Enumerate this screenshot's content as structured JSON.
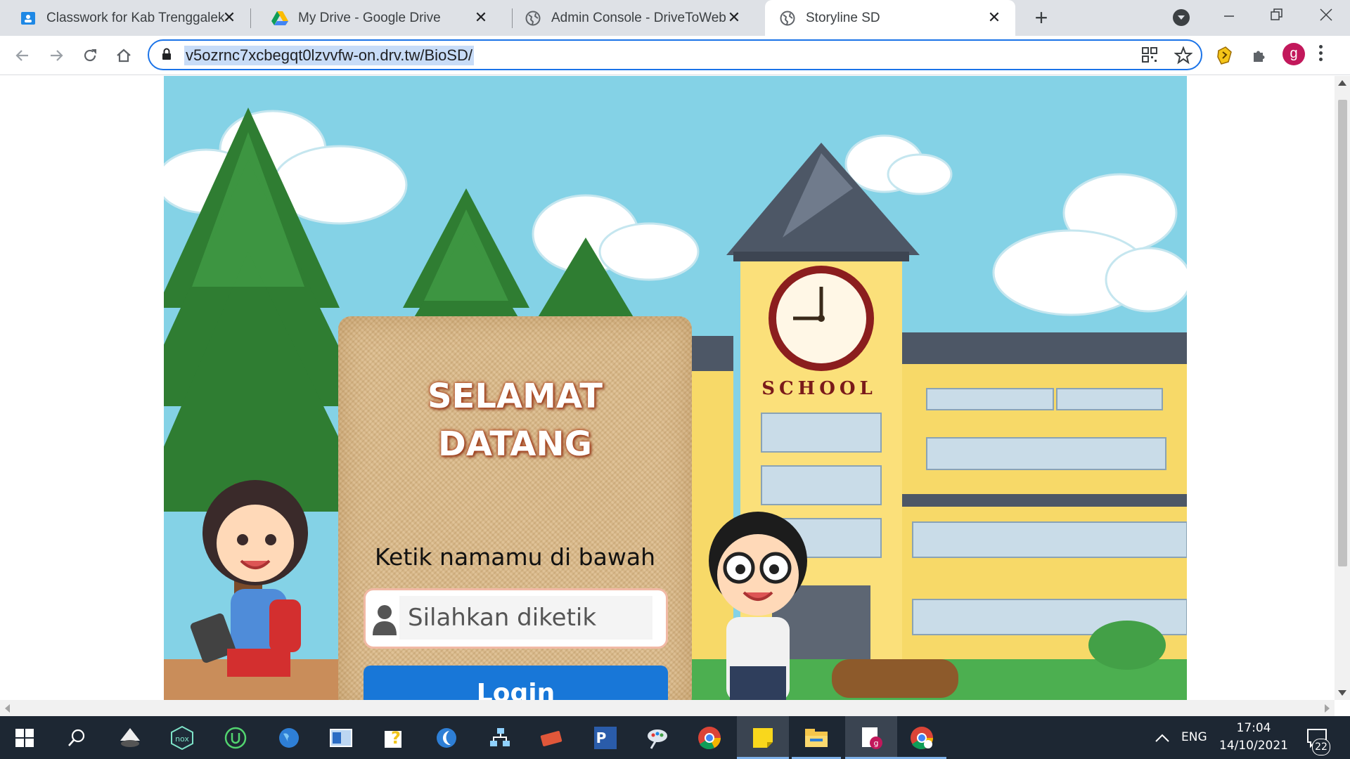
{
  "browser": {
    "tabs": [
      {
        "title": "Classwork for Kab Trenggalek: Pe",
        "icon": "google-classroom-icon",
        "active": false
      },
      {
        "title": "My Drive - Google Drive",
        "icon": "google-drive-icon",
        "active": false
      },
      {
        "title": "Admin Console - DriveToWeb",
        "icon": "globe-icon",
        "active": false
      },
      {
        "title": "Storyline SD",
        "icon": "globe-icon",
        "active": true
      }
    ],
    "close_glyph": "✕",
    "new_tab_glyph": "+",
    "url": "v5ozrnc7xcbegqt0lzvvfw-on.drv.tw/BioSD/",
    "profile_initial": "g"
  },
  "login": {
    "welcome_line1": "SELAMAT",
    "welcome_line2": "DATANG",
    "prompt": "Ketik namamu di bawah",
    "name_placeholder": "Silahkan diketik",
    "login_button": "Login"
  },
  "scene": {
    "school_sign": "SCHOOL"
  },
  "taskbar": {
    "language": "ENG",
    "time": "17:04",
    "date": "14/10/2021",
    "notification_count": "22"
  }
}
